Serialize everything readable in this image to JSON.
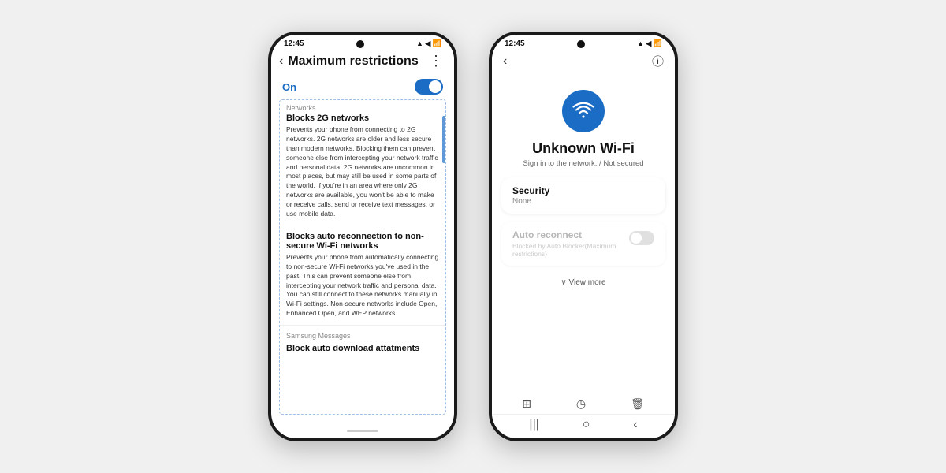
{
  "page": {
    "background": "#f0f0f0"
  },
  "phone1": {
    "status_time": "12:45",
    "header": {
      "back_label": "‹",
      "title": "Maximum restrictions",
      "more_label": "⋮"
    },
    "toggle": {
      "label": "On",
      "state": "on"
    },
    "content": {
      "section1_label": "Networks",
      "block1_title": "Blocks 2G networks",
      "block1_text": "Prevents your phone from connecting to 2G networks. 2G networks are older and less secure than modern networks. Blocking them can prevent someone else from intercepting your network traffic and personal data. 2G networks are uncommon in most places, but may still be used in some parts of the world. If you're in an area where only 2G networks are available, you won't be able to make or receive calls, send or receive text messages, or use mobile data.",
      "block2_title": "Blocks auto reconnection to non-secure Wi-Fi networks",
      "block2_text": "Prevents your phone from automatically connecting to non-secure Wi-Fi networks you've used in the past. This can prevent someone else from intercepting your network traffic and personal data. You can still connect to these networks manually in Wi-Fi settings. Non-secure networks include Open, Enhanced Open, and WEP networks.",
      "section2_label": "Samsung Messages",
      "block3_title": "Block auto download attatments"
    }
  },
  "phone2": {
    "status_time": "12:45",
    "header": {
      "back_label": "‹",
      "info_label": "ⓘ"
    },
    "wifi_icon": "wifi",
    "network_name": "Unknown Wi-Fi",
    "network_sub": "Sign in to the network. / Not secured",
    "security": {
      "label": "Security",
      "value": "None"
    },
    "auto_reconnect": {
      "label": "Auto reconnect",
      "sub": "Blocked by Auto Blocker(Maximum restrictions)",
      "state": "off"
    },
    "view_more_label": "∨  View more",
    "bottom_icons": {
      "qr_label": "⊞",
      "share_label": "◷",
      "delete_label": "🗑"
    },
    "nav": {
      "menu_label": "|||",
      "home_label": "○",
      "back_label": "‹"
    }
  }
}
